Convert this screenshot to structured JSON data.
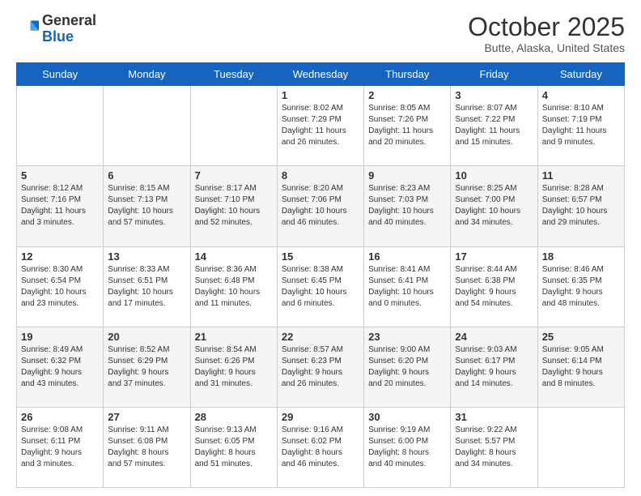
{
  "header": {
    "logo": {
      "general": "General",
      "blue": "Blue"
    },
    "title": "October 2025",
    "location": "Butte, Alaska, United States"
  },
  "days_of_week": [
    "Sunday",
    "Monday",
    "Tuesday",
    "Wednesday",
    "Thursday",
    "Friday",
    "Saturday"
  ],
  "weeks": [
    [
      {
        "day": "",
        "info": ""
      },
      {
        "day": "",
        "info": ""
      },
      {
        "day": "",
        "info": ""
      },
      {
        "day": "1",
        "info": "Sunrise: 8:02 AM\nSunset: 7:29 PM\nDaylight: 11 hours\nand 26 minutes."
      },
      {
        "day": "2",
        "info": "Sunrise: 8:05 AM\nSunset: 7:26 PM\nDaylight: 11 hours\nand 20 minutes."
      },
      {
        "day": "3",
        "info": "Sunrise: 8:07 AM\nSunset: 7:22 PM\nDaylight: 11 hours\nand 15 minutes."
      },
      {
        "day": "4",
        "info": "Sunrise: 8:10 AM\nSunset: 7:19 PM\nDaylight: 11 hours\nand 9 minutes."
      }
    ],
    [
      {
        "day": "5",
        "info": "Sunrise: 8:12 AM\nSunset: 7:16 PM\nDaylight: 11 hours\nand 3 minutes."
      },
      {
        "day": "6",
        "info": "Sunrise: 8:15 AM\nSunset: 7:13 PM\nDaylight: 10 hours\nand 57 minutes."
      },
      {
        "day": "7",
        "info": "Sunrise: 8:17 AM\nSunset: 7:10 PM\nDaylight: 10 hours\nand 52 minutes."
      },
      {
        "day": "8",
        "info": "Sunrise: 8:20 AM\nSunset: 7:06 PM\nDaylight: 10 hours\nand 46 minutes."
      },
      {
        "day": "9",
        "info": "Sunrise: 8:23 AM\nSunset: 7:03 PM\nDaylight: 10 hours\nand 40 minutes."
      },
      {
        "day": "10",
        "info": "Sunrise: 8:25 AM\nSunset: 7:00 PM\nDaylight: 10 hours\nand 34 minutes."
      },
      {
        "day": "11",
        "info": "Sunrise: 8:28 AM\nSunset: 6:57 PM\nDaylight: 10 hours\nand 29 minutes."
      }
    ],
    [
      {
        "day": "12",
        "info": "Sunrise: 8:30 AM\nSunset: 6:54 PM\nDaylight: 10 hours\nand 23 minutes."
      },
      {
        "day": "13",
        "info": "Sunrise: 8:33 AM\nSunset: 6:51 PM\nDaylight: 10 hours\nand 17 minutes."
      },
      {
        "day": "14",
        "info": "Sunrise: 8:36 AM\nSunset: 6:48 PM\nDaylight: 10 hours\nand 11 minutes."
      },
      {
        "day": "15",
        "info": "Sunrise: 8:38 AM\nSunset: 6:45 PM\nDaylight: 10 hours\nand 6 minutes."
      },
      {
        "day": "16",
        "info": "Sunrise: 8:41 AM\nSunset: 6:41 PM\nDaylight: 10 hours\nand 0 minutes."
      },
      {
        "day": "17",
        "info": "Sunrise: 8:44 AM\nSunset: 6:38 PM\nDaylight: 9 hours\nand 54 minutes."
      },
      {
        "day": "18",
        "info": "Sunrise: 8:46 AM\nSunset: 6:35 PM\nDaylight: 9 hours\nand 48 minutes."
      }
    ],
    [
      {
        "day": "19",
        "info": "Sunrise: 8:49 AM\nSunset: 6:32 PM\nDaylight: 9 hours\nand 43 minutes."
      },
      {
        "day": "20",
        "info": "Sunrise: 8:52 AM\nSunset: 6:29 PM\nDaylight: 9 hours\nand 37 minutes."
      },
      {
        "day": "21",
        "info": "Sunrise: 8:54 AM\nSunset: 6:26 PM\nDaylight: 9 hours\nand 31 minutes."
      },
      {
        "day": "22",
        "info": "Sunrise: 8:57 AM\nSunset: 6:23 PM\nDaylight: 9 hours\nand 26 minutes."
      },
      {
        "day": "23",
        "info": "Sunrise: 9:00 AM\nSunset: 6:20 PM\nDaylight: 9 hours\nand 20 minutes."
      },
      {
        "day": "24",
        "info": "Sunrise: 9:03 AM\nSunset: 6:17 PM\nDaylight: 9 hours\nand 14 minutes."
      },
      {
        "day": "25",
        "info": "Sunrise: 9:05 AM\nSunset: 6:14 PM\nDaylight: 9 hours\nand 8 minutes."
      }
    ],
    [
      {
        "day": "26",
        "info": "Sunrise: 9:08 AM\nSunset: 6:11 PM\nDaylight: 9 hours\nand 3 minutes."
      },
      {
        "day": "27",
        "info": "Sunrise: 9:11 AM\nSunset: 6:08 PM\nDaylight: 8 hours\nand 57 minutes."
      },
      {
        "day": "28",
        "info": "Sunrise: 9:13 AM\nSunset: 6:05 PM\nDaylight: 8 hours\nand 51 minutes."
      },
      {
        "day": "29",
        "info": "Sunrise: 9:16 AM\nSunset: 6:02 PM\nDaylight: 8 hours\nand 46 minutes."
      },
      {
        "day": "30",
        "info": "Sunrise: 9:19 AM\nSunset: 6:00 PM\nDaylight: 8 hours\nand 40 minutes."
      },
      {
        "day": "31",
        "info": "Sunrise: 9:22 AM\nSunset: 5:57 PM\nDaylight: 8 hours\nand 34 minutes."
      },
      {
        "day": "",
        "info": ""
      }
    ]
  ]
}
